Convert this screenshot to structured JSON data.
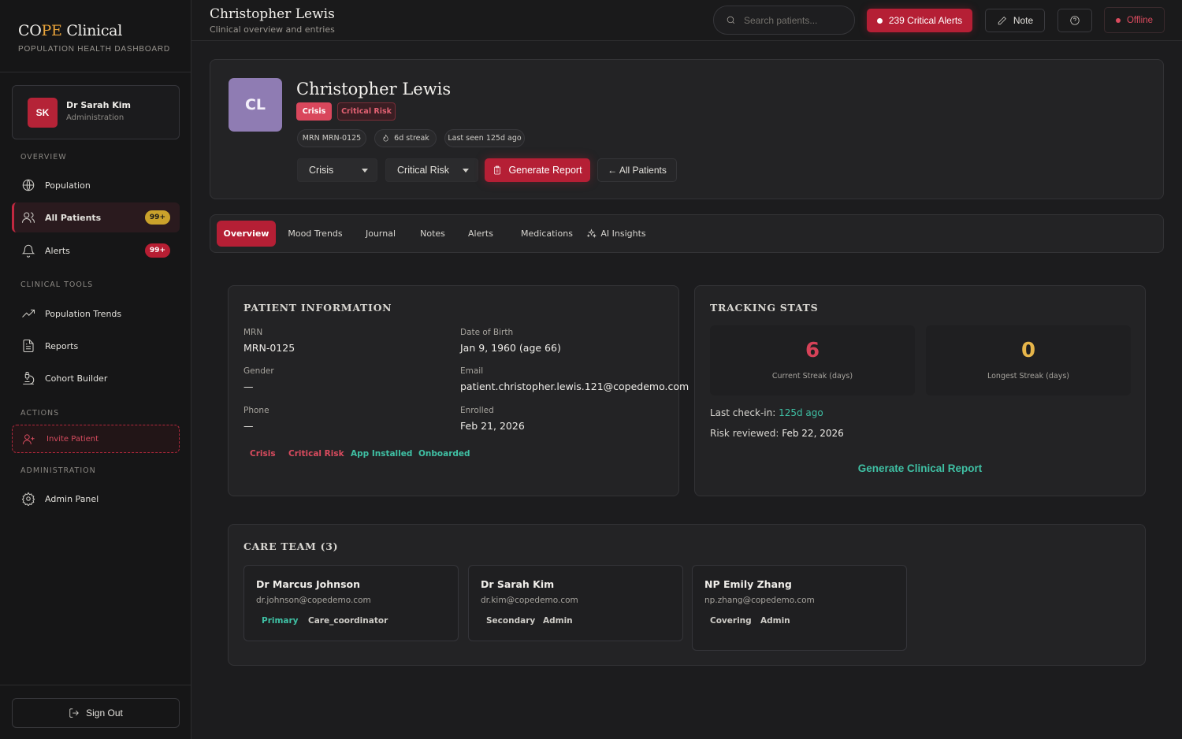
{
  "brand": {
    "name_a": "CO",
    "name_b": "PE",
    "name_c": " Clinical",
    "subtitle": "POPULATION HEALTH DASHBOARD"
  },
  "user": {
    "initials": "SK",
    "name": "Dr Sarah Kim",
    "role": "Administration"
  },
  "nav": {
    "overview_label": "OVERVIEW",
    "population": "Population",
    "all_patients": "All Patients",
    "all_patients_badge": "99+",
    "alerts": "Alerts",
    "alerts_badge": "99+",
    "clinical_tools_label": "CLINICAL TOOLS",
    "population_trends": "Population Trends",
    "reports": "Reports",
    "cohort_builder": "Cohort Builder",
    "actions_label": "ACTIONS",
    "invite_patient": "Invite Patient",
    "administration_label": "ADMINISTRATION",
    "admin_panel": "Admin Panel",
    "sign_out": "Sign Out"
  },
  "topbar": {
    "title": "Christopher Lewis",
    "subtitle": "Clinical overview and entries",
    "search_placeholder": "Search patients...",
    "critical_alerts": "239 Critical Alerts",
    "note": "Note",
    "status": "Offline"
  },
  "patient": {
    "initials": "CL",
    "name": "Christopher Lewis",
    "badge_crisis": "Crisis",
    "badge_risk": "Critical Risk",
    "mrn_chip": "MRN MRN-0125",
    "streak_chip": "6d streak",
    "last_seen_chip": "Last seen 125d ago",
    "status_select": "Crisis",
    "risk_select": "Critical Risk",
    "generate_report": "Generate Report",
    "all_patients": "← All Patients"
  },
  "tabs": [
    "Overview",
    "Mood Trends",
    "Journal",
    "Notes",
    "Alerts",
    "Medications",
    "AI Insights"
  ],
  "info": {
    "title": "PATIENT INFORMATION",
    "mrn_label": "MRN",
    "mrn": "MRN-0125",
    "dob_label": "Date of Birth",
    "dob": "Jan 9, 1960 (age 66)",
    "gender_label": "Gender",
    "gender": "—",
    "email_label": "Email",
    "email": "patient.christopher.lewis.121@copedemo.com",
    "phone_label": "Phone",
    "phone": "—",
    "enrolled_label": "Enrolled",
    "enrolled": "Feb 21, 2026",
    "tags": [
      "Crisis",
      "Critical Risk",
      "App Installed",
      "Onboarded"
    ]
  },
  "tracking": {
    "title": "TRACKING STATS",
    "current_streak": "6",
    "current_streak_label": "Current Streak (days)",
    "longest_streak": "0",
    "longest_streak_label": "Longest Streak (days)",
    "last_checkin_label": "Last check-in: ",
    "last_checkin": "125d ago",
    "risk_reviewed_label": "Risk reviewed: ",
    "risk_reviewed": "Feb 22, 2026",
    "generate_clinical_report": "Generate Clinical Report"
  },
  "care_team": {
    "title": "CARE TEAM (3)",
    "members": [
      {
        "name": "Dr Marcus Johnson",
        "email": "dr.johnson@copedemo.com",
        "role": "Primary",
        "type": "Care_coordinator"
      },
      {
        "name": "Dr Sarah Kim",
        "email": "dr.kim@copedemo.com",
        "role": "Secondary",
        "type": "Admin"
      },
      {
        "name": "NP Emily Zhang",
        "email": "np.zhang@copedemo.com",
        "role": "Covering",
        "type": "Admin"
      }
    ]
  },
  "colors": {
    "accent": "#b51f35",
    "teal": "#3fc0a4",
    "gold": "#caa22b",
    "avatar": "#8f7cb3"
  }
}
